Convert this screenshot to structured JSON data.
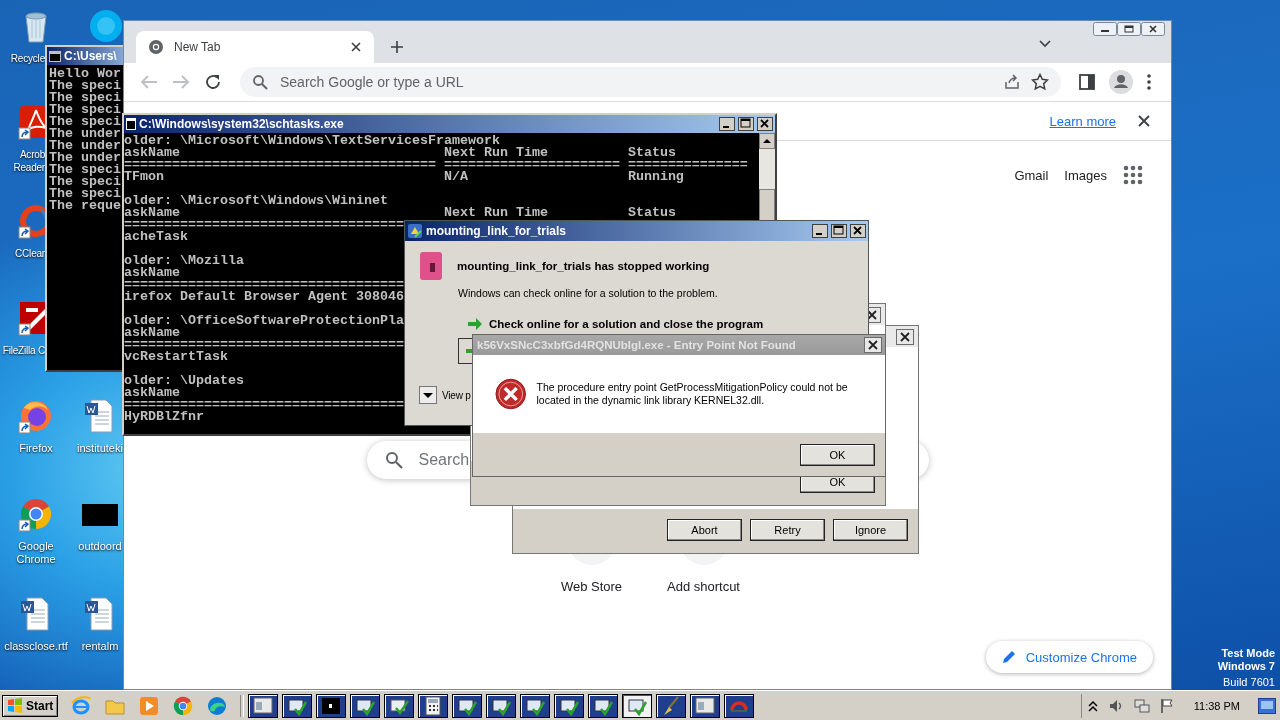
{
  "desktop": {
    "icons": [
      {
        "kind": "recycle",
        "label_lines": [
          "Recycle"
        ]
      },
      {
        "kind": "skype"
      },
      {
        "kind": "acrobat",
        "label_lines": [
          "Acrob",
          "Reader"
        ]
      },
      {
        "kind": "ccleaner",
        "label_lines": [
          "CClear"
        ]
      },
      {
        "kind": "filezilla",
        "label_lines": [
          "FileZilla C"
        ]
      },
      {
        "kind": "firefox",
        "label_lines": [
          "Firefox"
        ]
      },
      {
        "kind": "word",
        "label_lines": [
          "instituteki"
        ]
      },
      {
        "kind": "chrome",
        "label_lines": [
          "Google",
          "Chrome"
        ]
      },
      {
        "kind": "blackfile",
        "label_lines": [
          "outdoord"
        ]
      },
      {
        "kind": "word",
        "label_lines": [
          "classclose.rtf"
        ]
      },
      {
        "kind": "word",
        "label_lines": [
          "rentalm"
        ]
      }
    ],
    "system_text": [
      "Test Mode",
      "Windows 7",
      "Build 7601"
    ]
  },
  "console": {
    "title": "C:\\Users\\",
    "lines": [
      "Hello Wor",
      "The speci",
      "The speci",
      "The speci",
      "The speci",
      "The under",
      "The under",
      "The under",
      "The speci",
      "The speci",
      "The speci",
      "The reque"
    ]
  },
  "browser": {
    "tab": {
      "label": "New Tab",
      "selected": true
    },
    "omnibox": {
      "placeholder": "Search Google or type a URL"
    },
    "infobar": {
      "link": "Learn more"
    },
    "top_links": [
      "Gmail",
      "Images"
    ],
    "search": {
      "placeholder": "Search"
    },
    "shortcuts": [
      "Web Store",
      "Add shortcut"
    ],
    "customize_button": "Customize Chrome"
  },
  "schtasks": {
    "title": "C:\\Windows\\system32\\schtasks.exe",
    "blocks": [
      {
        "lines": [
          "older: \\Microsoft\\Windows\\TextServicesFramework",
          "askName                                 Next Run Time          Status",
          "======================================= ====================== ===============",
          "TFmon                                   N/A                    Running"
        ]
      },
      {
        "lines": [
          "older: \\Microsoft\\Windows\\Wininet",
          "askName                                 Next Run Time          Status",
          "===================================",
          "acheTask"
        ]
      },
      {
        "lines": [
          "older: \\Mozilla",
          "askName",
          "===================================",
          "irefox Default Browser Agent 308046"
        ]
      },
      {
        "lines": [
          "older: \\OfficeSoftwareProtectionPla",
          "askName",
          "===================================",
          "vcRestartTask"
        ]
      },
      {
        "lines": [
          "older: \\Updates",
          "askName",
          "===================================",
          "HyRDBlZfnr"
        ]
      }
    ]
  },
  "background_dialogs": [
    {
      "buttons": [
        "Abort",
        "Retry",
        "Ignore"
      ]
    },
    {
      "buttons": [
        "OK"
      ]
    }
  ],
  "crash_dialog": {
    "title": "mounting_link_for_trials",
    "heading": "mounting_link_for_trials has stopped working",
    "text": "Windows can check online for a solution to the problem.",
    "action": "Check online for a solution and close the program",
    "details_link": "View p"
  },
  "error_dialog": {
    "title": "k56VxSNcC3xbfGd4RQNUbIgl.exe - Entry Point Not Found",
    "message": "The procedure entry point GetProcessMitigationPolicy could not be located in the dynamic link library KERNEL32.dll.",
    "button": "OK"
  },
  "taskbar": {
    "start": "Start",
    "quick_launch": [
      {
        "kind": "ie"
      },
      {
        "kind": "folder"
      },
      {
        "kind": "media"
      },
      {
        "kind": "chrome"
      },
      {
        "kind": "edge"
      }
    ],
    "tasks": [
      {
        "kind": "window",
        "selected": false
      },
      {
        "kind": "setup",
        "selected": false
      },
      {
        "kind": "console",
        "selected": false
      },
      {
        "kind": "setup",
        "selected": false
      },
      {
        "kind": "check",
        "selected": false
      },
      {
        "kind": "calc",
        "selected": false
      },
      {
        "kind": "setup",
        "selected": false
      },
      {
        "kind": "setup",
        "selected": false
      },
      {
        "kind": "setup",
        "selected": false
      },
      {
        "kind": "setup",
        "selected": false
      },
      {
        "kind": "setup",
        "selected": false
      },
      {
        "kind": "setup",
        "selected": true
      },
      {
        "kind": "brush",
        "selected": false
      },
      {
        "kind": "window",
        "selected": false
      },
      {
        "kind": "arc",
        "selected": false
      }
    ],
    "clock": "11:38 PM"
  }
}
